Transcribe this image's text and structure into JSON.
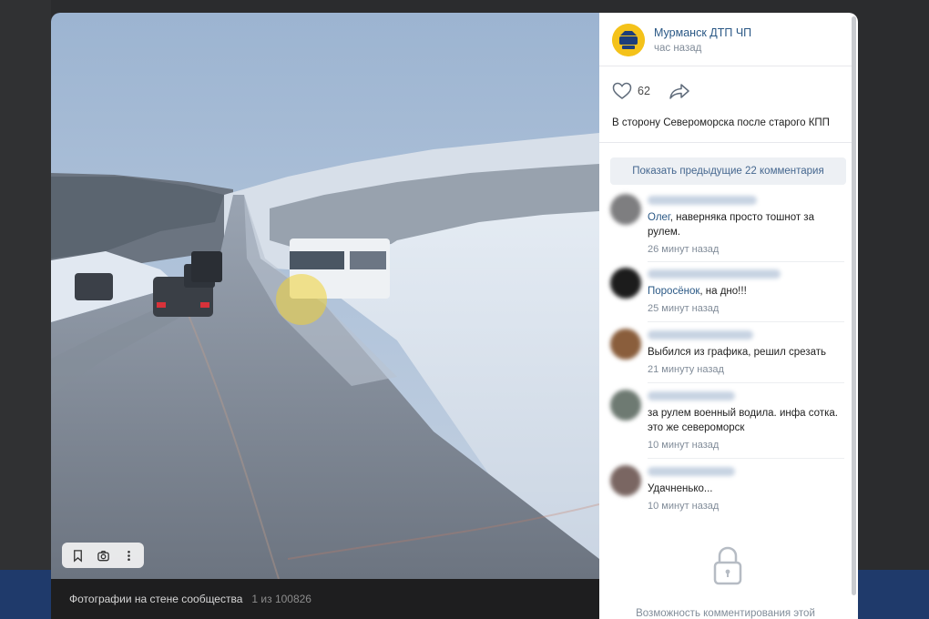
{
  "viewer": {
    "album": "Фотографии на стене сообщества",
    "counter": "1 из 100826"
  },
  "toolbar": {
    "icons": [
      "bookmark-icon",
      "camera-icon",
      "more-vertical-icon"
    ]
  },
  "post": {
    "author": "Мурманск ДТП ЧП",
    "time": "час назад",
    "likes": "62",
    "caption": "В сторону Североморска после старого КПП"
  },
  "comments": {
    "show_previous": "Показать предыдущие 22 комментария",
    "items": [
      {
        "mention": "Олег",
        "text": ", наверняка просто тошнот за рулем.",
        "time": "26 минут назад",
        "avatar_color": "#7e7e80"
      },
      {
        "mention": "Поросёнок",
        "text": ", на дно!!!",
        "time": "25 минут назад",
        "avatar_color": "#1c1c1c"
      },
      {
        "mention": "",
        "text": "Выбился из графика, решил срезать",
        "time": "21 минуту назад",
        "avatar_color": "#8a5e3c"
      },
      {
        "mention": "",
        "text": "за рулем военный водила. инфа сотка. это же североморск",
        "time": "10 минут назад",
        "avatar_color": "#6e7a72"
      },
      {
        "mention": "",
        "text": "Удачненько...",
        "time": "10 минут назад",
        "avatar_color": "#7a6662"
      }
    ],
    "closed_notice": "Возможность комментирования этой"
  },
  "colors": {
    "link": "#2a5885",
    "meta": "#818c99",
    "accent_bar": "#1f3a6b"
  }
}
